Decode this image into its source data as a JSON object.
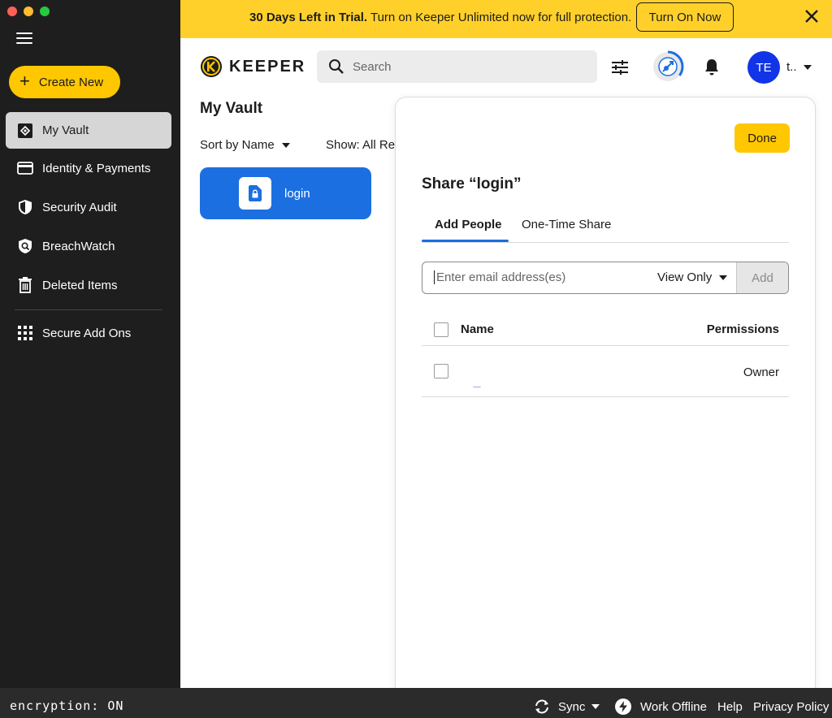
{
  "window": {
    "traffic_colors": [
      "#ff5f57",
      "#febc2e",
      "#28c840"
    ]
  },
  "sidebar": {
    "create_label": "Create New",
    "items": [
      {
        "label": "My Vault",
        "icon": "vault-icon",
        "active": true
      },
      {
        "label": "Identity & Payments",
        "icon": "card-icon"
      },
      {
        "label": "Security Audit",
        "icon": "shield-icon"
      },
      {
        "label": "BreachWatch",
        "icon": "breachwatch-icon"
      },
      {
        "label": "Deleted Items",
        "icon": "trash-icon"
      }
    ],
    "addons_label": "Secure Add Ons"
  },
  "banner": {
    "bold_text": "30 Days Left in Trial.",
    "text": " Turn on Keeper Unlimited now for full protection.",
    "button_label": "Turn On Now",
    "bg_color": "#ffd02a"
  },
  "header": {
    "logo_text": "KEEPER",
    "search_placeholder": "Search",
    "avatar_initials": "TE",
    "user_name": "t.."
  },
  "vault": {
    "title": "My Vault",
    "sort_label": "Sort by Name",
    "show_label": "Show: All Rec",
    "records": [
      {
        "label": "login"
      }
    ],
    "accent_color": "#1c6fe0"
  },
  "share": {
    "done_label": "Done",
    "title": "Share “login”",
    "tabs": [
      {
        "label": "Add People",
        "active": true
      },
      {
        "label": "One-Time Share"
      }
    ],
    "email_placeholder": "Enter email address(es)",
    "permission_value": "View Only",
    "add_label": "Add",
    "columns": {
      "name": "Name",
      "permissions": "Permissions"
    },
    "rows": [
      {
        "name": "",
        "permission": "Owner"
      }
    ]
  },
  "footer": {
    "encryption": "encryption: ON",
    "sync_label": "Sync",
    "offline_label": "Work Offline",
    "help_label": "Help",
    "privacy_label": "Privacy Policy"
  }
}
